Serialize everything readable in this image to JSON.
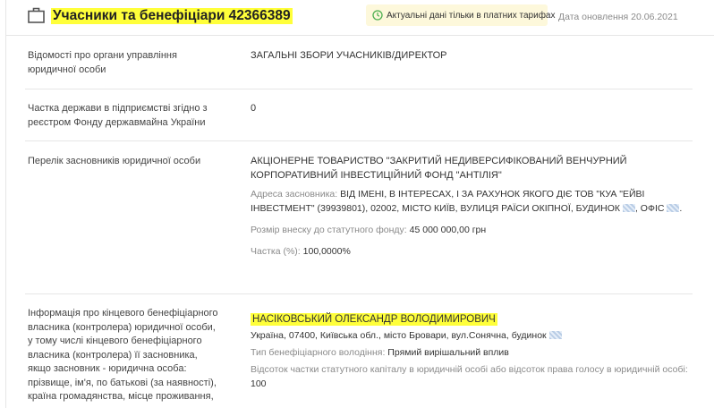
{
  "header": {
    "title": "Учасники та бенефіціари 42366389",
    "badge": "Актуальні дані тільки в платних тарифах",
    "updated": "Дата оновлення 20.06.2021"
  },
  "rows": [
    {
      "label": "Відомості про органи управління юридичної особи",
      "value": "ЗАГАЛЬНІ ЗБОРИ УЧАСНИКІВ/ДИРЕКТОР"
    },
    {
      "label": "Частка держави в підприємстві згідно з реєстром Фонду державмайна України",
      "value": "0"
    },
    {
      "label": "Перелік засновників юридичної особи",
      "name": "АКЦІОНЕРНЕ ТОВАРИСТВО \"ЗАКРИТИЙ НЕДИВЕРСИФІКОВАНИЙ ВЕНЧУРНИЙ КОРПОРАТИВНИЙ ІНВЕСТИЦІЙНИЙ ФОНД \"АНТІЛІЯ\"",
      "address_key": "Адреса засновника:",
      "address_value": "ВІД ІМЕНІ, В ІНТЕРЕСАХ, І ЗА РАХУНОК ЯКОГО ДІЄ ТОВ \"КУА \"ЕЙВІ ІНВЕСТМЕНТ\" (39939801), 02002, МІСТО КИЇВ, ВУЛИЦЯ РАЇСИ ОКІПНОЇ, БУДИНОК",
      "address_tail": ", ОФІС",
      "address_end": ".",
      "capital_key": "Розмір внеску до статутного фонду:",
      "capital_value": "45 000 000,00 грн",
      "share_key": "Частка (%):",
      "share_value": "100,0000%"
    },
    {
      "label": "Інформація про кінцевого бенефіціарного власника (контролера) юридичної особи, у тому числі кінцевого бенефіціарного власника (контролера) її засновника, якщо засновник - юридична особа: прізвище, ім'я, по батькові (за наявності), країна громадянства, місце проживання,",
      "name": "НАСІКОВСЬКИЙ ОЛЕКСАНДР ВОЛОДИМИРОВИЧ",
      "address": "Україна, 07400, Київська обл., місто Бровари, вул.Сонячна, будинок",
      "type_key": "Тип бенефіціарного володіння:",
      "type_value": "Прямий вирішальний вплив",
      "percent_key": "Відсоток частки статутного капіталу в юридичній особі або відсоток права голосу в юридичній особі:",
      "percent_value": "100"
    }
  ]
}
